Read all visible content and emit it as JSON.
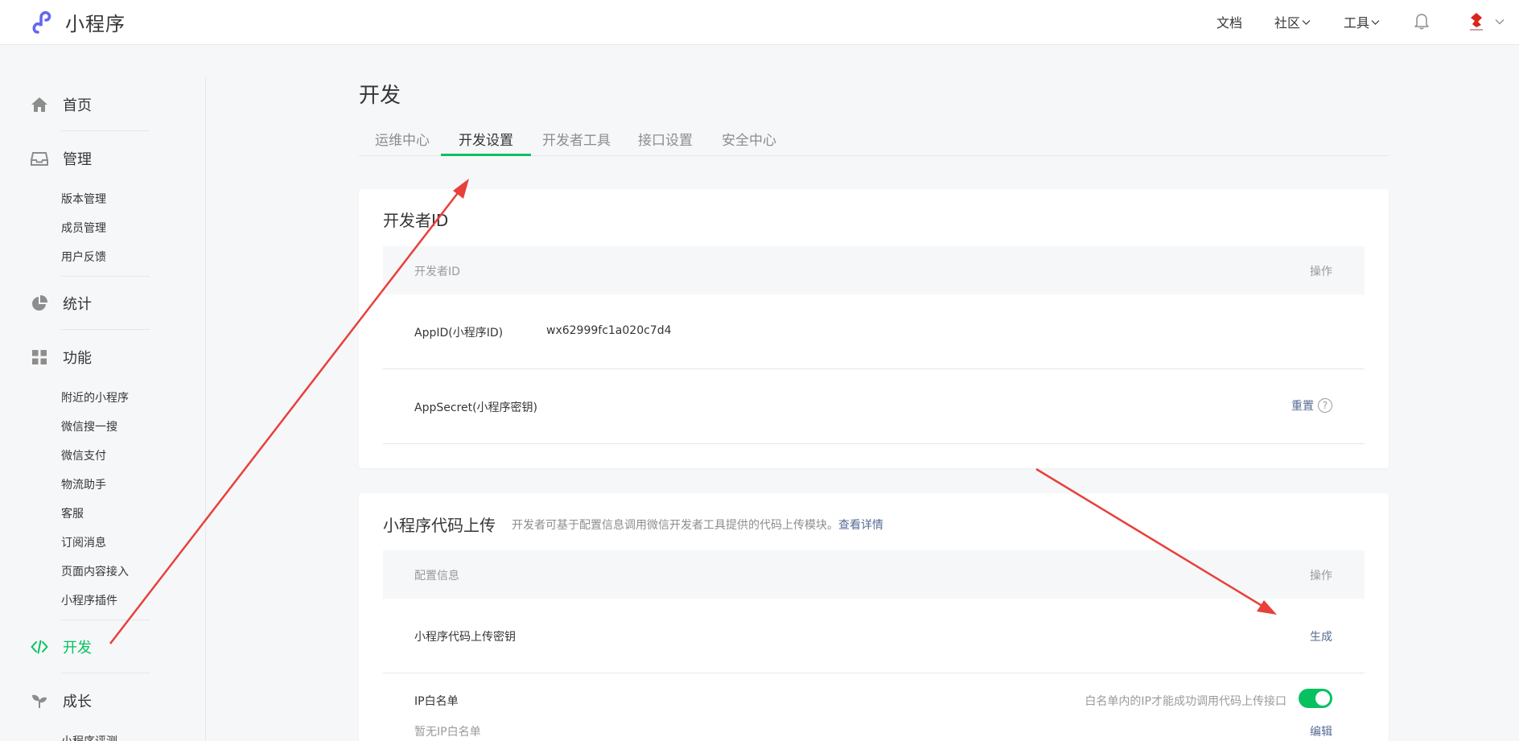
{
  "header": {
    "app_name": "小程序",
    "nav": [
      "文档",
      "社区",
      "工具"
    ],
    "accent_color": "#07c160",
    "logo_color": "#6467f0"
  },
  "sidebar": {
    "home": "首页",
    "manage": {
      "label": "管理",
      "items": [
        "版本管理",
        "成员管理",
        "用户反馈"
      ]
    },
    "stats": "统计",
    "features": {
      "label": "功能",
      "items": [
        "附近的小程序",
        "微信搜一搜",
        "微信支付",
        "物流助手",
        "客服",
        "订阅消息",
        "页面内容接入",
        "小程序插件"
      ]
    },
    "develop": "开发",
    "growth": {
      "label": "成长",
      "items": [
        "小程序评测"
      ]
    }
  },
  "main": {
    "title": "开发",
    "tabs": [
      "运维中心",
      "开发设置",
      "开发者工具",
      "接口设置",
      "安全中心"
    ],
    "active_tab": "开发设置",
    "dev_id_card": {
      "title": "开发者ID",
      "col_left": "开发者ID",
      "col_right": "操作",
      "appid_label": "AppID(小程序ID)",
      "appid_value": "wx62999fc1a020c7d4",
      "secret_label": "AppSecret(小程序密钥)",
      "reset_label": "重置",
      "help_glyph": "?"
    },
    "upload_card": {
      "title": "小程序代码上传",
      "desc": "开发者可基于配置信息调用微信开发者工具提供的代码上传模块。",
      "desc_link": "查看详情",
      "col_left": "配置信息",
      "col_right": "操作",
      "key_label": "小程序代码上传密钥",
      "generate_label": "生成",
      "ip_label": "IP白名单",
      "ip_empty": "暂无IP白名单",
      "ip_hint": "白名单内的IP才能成功调用代码上传接口",
      "ip_toggle_on": true,
      "edit_label": "编辑"
    }
  },
  "annotation": {
    "arrow_color": "#e8403b"
  }
}
